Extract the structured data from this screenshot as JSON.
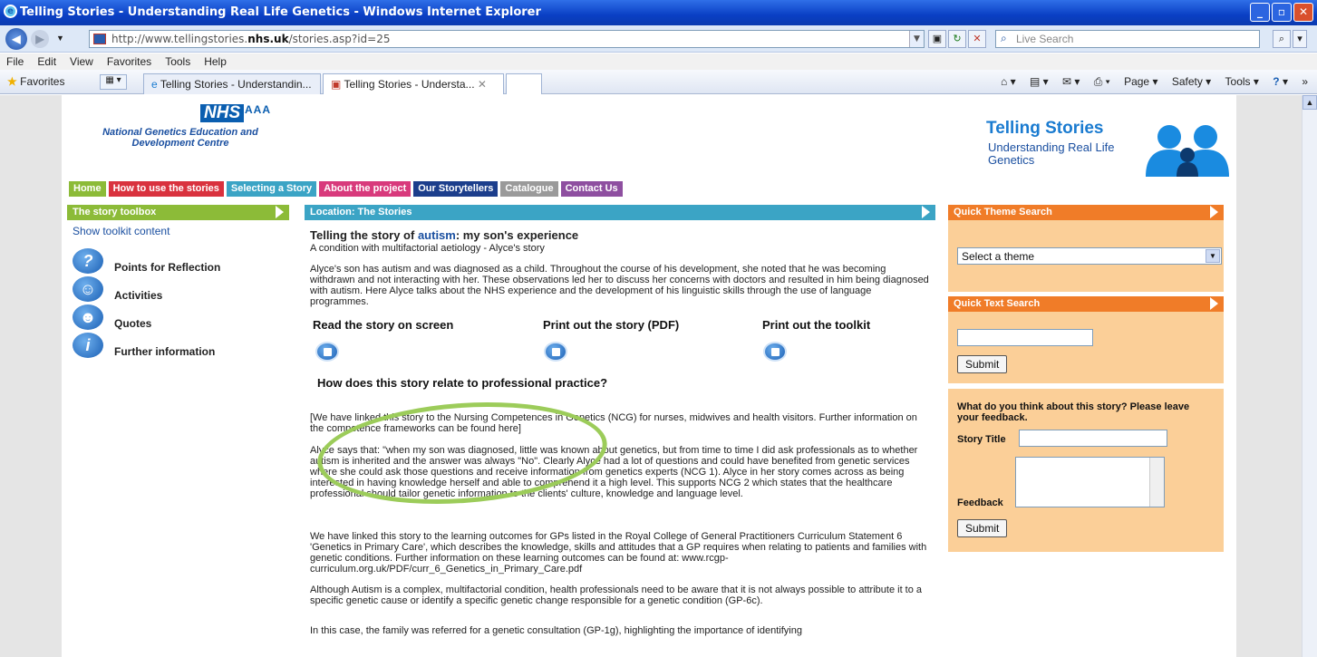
{
  "window": {
    "title": "Telling Stories - Understanding Real Life Genetics - Windows Internet Explorer",
    "btn_min": "_",
    "btn_max": "▫",
    "btn_close": "✕"
  },
  "address": {
    "url_prefix": "http://www.tellingstories.",
    "url_domain": "nhs.uk",
    "url_suffix": "/stories.asp?id=25",
    "search_placeholder": "Live Search"
  },
  "menu": [
    "File",
    "Edit",
    "View",
    "Favorites",
    "Tools",
    "Help"
  ],
  "favbar": {
    "favorites": "Favorites",
    "tab1": "Telling Stories - Understandin...",
    "tab2": "Telling Stories - Understa...",
    "tab_close": "✕"
  },
  "commands": {
    "page": "Page ▾",
    "safety": "Safety ▾",
    "tools": "Tools ▾",
    "help": "?",
    "more": "»"
  },
  "site": {
    "nhs": "NHS",
    "aaa": "AAA",
    "org": "National Genetics Education and Development Centre",
    "brand_title": "Telling Stories",
    "brand_sub": "Understanding Real Life Genetics"
  },
  "nav": [
    {
      "label": "Home",
      "color": "#8cbb38"
    },
    {
      "label": "How to use the stories",
      "color": "#d9323e"
    },
    {
      "label": "Selecting a Story",
      "color": "#3ba4c5"
    },
    {
      "label": "About the project",
      "color": "#d83a7c"
    },
    {
      "label": "Our Storytellers",
      "color": "#1c3e8c"
    },
    {
      "label": "Catalogue",
      "color": "#9a9a9a"
    },
    {
      "label": "Contact Us",
      "color": "#8e4fa0"
    }
  ],
  "toolbox": {
    "header": "The story toolbox",
    "show": "Show toolkit content",
    "items": [
      {
        "label": "Points for Reflection",
        "glyph": "?"
      },
      {
        "label": "Activities",
        "glyph": "☺"
      },
      {
        "label": "Quotes",
        "glyph": "☻"
      },
      {
        "label": "Further information",
        "glyph": "i"
      }
    ]
  },
  "main": {
    "location": "Location: The Stories",
    "title_a": "Telling the story of ",
    "title_link": "autism",
    "title_b": ": my son's experience",
    "subtitle": "A condition with multifactorial aetiology - Alyce's story",
    "intro": "Alyce's son has autism and was diagnosed as a child. Throughout the course of his development, she noted that he was becoming withdrawn and not interacting with her. These observations led her to discuss her concerns with doctors and resulted in him being diagnosed with autism. Here Alyce talks about the NHS experience and the development of his linguistic skills through the use of language programmes.",
    "opt_read": "Read the story on screen",
    "opt_print": "Print out the story (PDF)",
    "opt_toolkit": "Print out the toolkit",
    "heading2": "How does this story relate to professional practice?",
    "p1": "[We have linked this story to the Nursing Competences in Genetics (NCG) for nurses, midwives and health visitors. Further information on the competence frameworks can be found here]",
    "p2": "Alyce says that: \"when my son was diagnosed, little was known about genetics, but from time to time I did ask professionals as to whether autism is inherited and the answer was always \"No\". Clearly Alyce had a lot of questions and could have benefited from genetic services where she could ask those questions and receive information from genetics experts (NCG 1). Alyce in her story comes across as being interested in having knowledge herself and able to comprehend it a high level. This supports NCG 2 which states that the healthcare professional should tailor genetic information to the clients' culture, knowledge and language level.",
    "p3": "We have linked this story to the learning outcomes for GPs listed in the Royal College of General Practitioners Curriculum Statement 6 'Genetics in Primary Care', which describes the knowledge, skills and attitudes that a GP requires when relating to patients and families with genetic conditions. Further information on these learning outcomes can be found at: www.rcgp-curriculum.org.uk/PDF/curr_6_Genetics_in_Primary_Care.pdf",
    "p4": "Although Autism is a complex, multifactorial condition, health professionals need to be aware that it is not always possible to attribute it to a specific genetic cause or identify a specific genetic change responsible for a genetic condition (GP-6c).",
    "p5": "In this case, the family was referred for a genetic consultation (GP-1g), highlighting the importance of identifying"
  },
  "right": {
    "theme_header": "Quick Theme Search",
    "theme_select": "Select a theme",
    "text_header": "Quick Text Search",
    "submit": "Submit",
    "feedback_prompt": "What do you think about this story? Please leave your feedback.",
    "story_title_label": "Story Title",
    "feedback_label": "Feedback"
  }
}
